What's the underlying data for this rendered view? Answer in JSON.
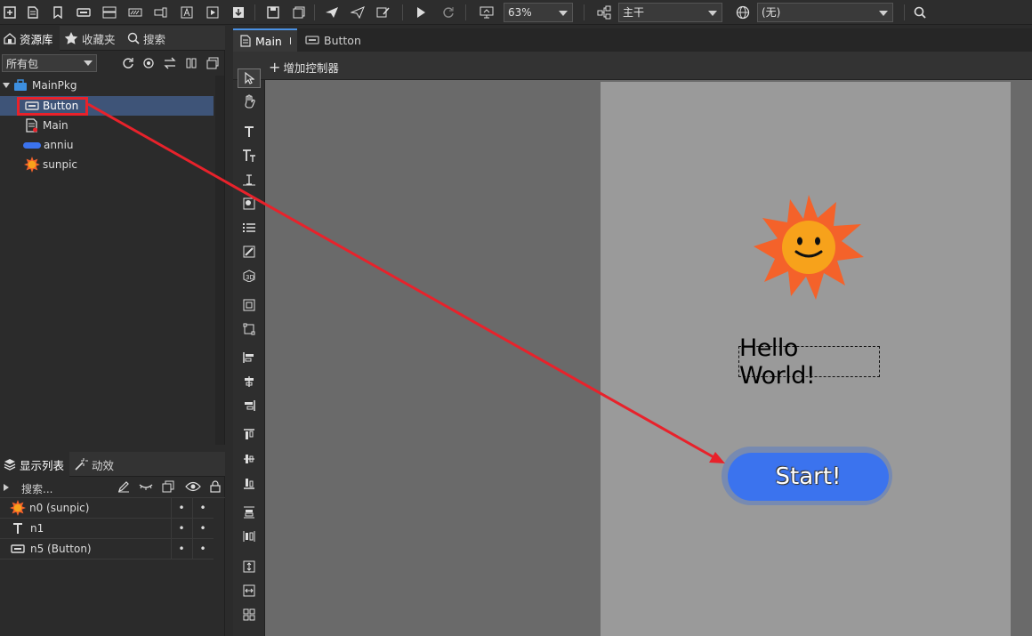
{
  "toolbar": {
    "zoom": "63%",
    "branch": "主干",
    "language": "(无)"
  },
  "library": {
    "tabs": [
      "资源库",
      "收藏夹",
      "搜索"
    ],
    "package_filter": "所有包",
    "tree": [
      {
        "label": "MainPkg"
      },
      {
        "label": "Button"
      },
      {
        "label": "Main"
      },
      {
        "label": "anniu"
      },
      {
        "label": "sunpic"
      }
    ]
  },
  "display_list": {
    "tabs": [
      "显示列表",
      "动效"
    ],
    "search_placeholder": "搜索...",
    "rows": [
      {
        "label": "n0 (sunpic)"
      },
      {
        "label": "n1"
      },
      {
        "label": "n5 (Button)"
      }
    ]
  },
  "editor": {
    "tabs": [
      "Main",
      "Button"
    ],
    "add_controller": "增加控制器",
    "hello_text": "Hello World!",
    "start_text": "Start!"
  },
  "colors": {
    "accent": "#3b73ee",
    "annotation": "#e8222b",
    "sun_outer": "#f4622a",
    "sun_inner": "#f7a21b"
  }
}
